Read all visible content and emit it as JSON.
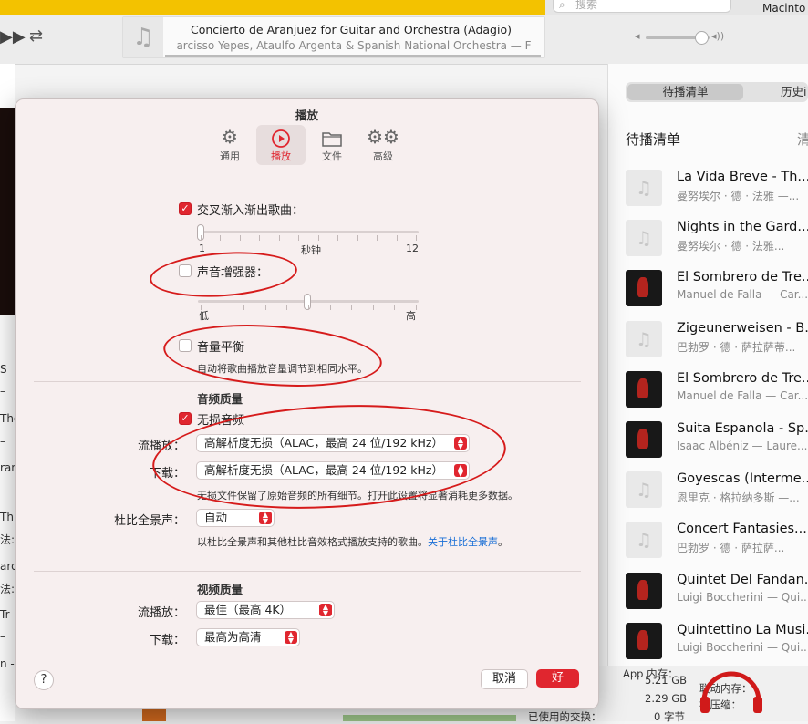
{
  "topbar": {
    "search_placeholder": "搜索",
    "computer_name": "Macinto",
    "now_playing_title": "Concierto de Aranjuez for Guitar and Orchestra (Adagio)",
    "now_playing_artist": "arcisso Yepes, Ataulfo Argenta & Spanish National Orchestra — F",
    "volume_level": 0.8
  },
  "right_panel": {
    "tabs": [
      "待播清单",
      "历史i"
    ],
    "heading": "待播清单",
    "clear_label": "清",
    "queue": [
      {
        "title": "La Vida Breve - Th...",
        "subtitle": "曼努埃尔 · 德 · 法雅 —...",
        "art": "placeholder"
      },
      {
        "title": "Nights in the Gard...",
        "subtitle": "曼努埃尔 · 德 · 法雅...",
        "art": "placeholder"
      },
      {
        "title": "El Sombrero de Tre...",
        "subtitle": "Manuel de Falla — Car...",
        "art": "dark"
      },
      {
        "title": "Zigeunerweisen - B...",
        "subtitle": "巴勃罗 · 德 · 萨拉萨蒂...",
        "art": "placeholder"
      },
      {
        "title": "El Sombrero de Tre...",
        "subtitle": "Manuel de Falla — Car...",
        "art": "dark"
      },
      {
        "title": "Suita Espanola - Sp...",
        "subtitle": "Isaac Albéniz — Laure...",
        "art": "dark"
      },
      {
        "title": "Goyescas (Interme...",
        "subtitle": "恩里克 · 格拉纳多斯 —...",
        "art": "placeholder"
      },
      {
        "title": "Concert Fantasies...",
        "subtitle": "巴勃罗 · 德 · 萨拉萨...",
        "art": "placeholder"
      },
      {
        "title": "Quintet Del Fandan...",
        "subtitle": "Luigi Boccherini — Qui...",
        "art": "dark"
      },
      {
        "title": "Quintettino La Musi...",
        "subtitle": "Luigi Boccherini — Qui...",
        "art": "dark"
      }
    ]
  },
  "left_fragments": [
    "S",
    "–",
    "The",
    "–",
    "ran",
    "–",
    "Th",
    "法:",
    "ard",
    "法:",
    "Tr",
    "–",
    "n -"
  ],
  "bottom_info": {
    "rows": [
      {
        "label": "App 内存：",
        "value": "5.21 GB"
      },
      {
        "label": "联动内存：",
        "value": "2.29 GB"
      },
      {
        "label": "已使用的交换：",
        "value": "0 字节"
      }
    ],
    "extra_label": "被压缩："
  },
  "dialog": {
    "title": "播放",
    "tabs": [
      {
        "label": "通用",
        "icon": "gear-icon"
      },
      {
        "label": "播放",
        "icon": "play-circle-icon"
      },
      {
        "label": "文件",
        "icon": "folder-icon"
      },
      {
        "label": "高级",
        "icon": "gears-icon"
      }
    ],
    "crossfade": {
      "label": "交叉渐入渐出歌曲：",
      "checked": true,
      "min": "1",
      "unit": "秒钟",
      "max": "12",
      "value": 1
    },
    "sound_enhancer": {
      "label": "声音增强器：",
      "checked": false,
      "low": "低",
      "high": "高",
      "value": 0.5
    },
    "sound_check": {
      "label": "音量平衡",
      "checked": false,
      "desc": "自动将歌曲播放音量调节到相同水平。"
    },
    "audio_quality": {
      "heading": "音频质量",
      "lossless": {
        "label": "无损音频",
        "checked": true
      },
      "streaming_label": "流播放：",
      "streaming_value": "高解析度无损（ALAC，最高 24 位/192 kHz）",
      "download_label": "下载：",
      "download_value": "高解析度无损（ALAC，最高 24 位/192 kHz）",
      "lossless_note": "无损文件保留了原始音频的所有细节。打开此设置将显著消耗更多数据。",
      "dolby_label": "杜比全景声：",
      "dolby_value": "自动",
      "dolby_note": "以杜比全景声和其他杜比音效格式播放支持的歌曲。",
      "dolby_link": "关于杜比全景声"
    },
    "video_quality": {
      "heading": "视频质量",
      "streaming_label": "流播放：",
      "streaming_value": "最佳（最高 4K）",
      "download_label": "下载：",
      "download_value": "最高为高清"
    },
    "help": "?",
    "cancel": "取消",
    "ok": "好"
  },
  "colors": {
    "accent": "#e0262f",
    "annotation": "#d61b1b",
    "topstrip": "#f3c200"
  }
}
